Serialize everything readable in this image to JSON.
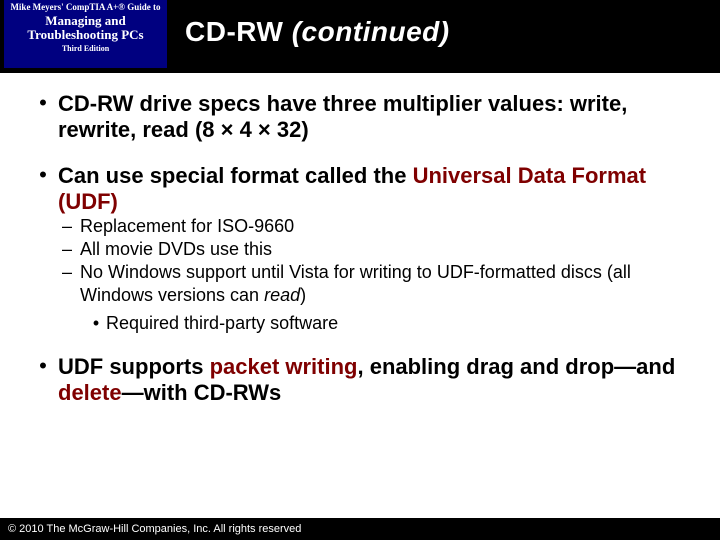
{
  "header": {
    "badge": {
      "line1": "Mike Meyers' CompTIA A+® Guide to",
      "line2": "Managing and Troubleshooting PCs",
      "line3": "Third Edition"
    },
    "title_main": "CD-RW ",
    "title_paren": "(continued)"
  },
  "bullets": {
    "b1_text": "CD-RW drive specs have three multiplier values: write, rewrite, read (8 × 4 × 32)",
    "b2_pre": "Can use special format called the ",
    "b2_accent": "Universal Data Format (UDF)",
    "b2_sub1": "Replacement for ISO-9660",
    "b2_sub2": "All movie DVDs use this",
    "b2_sub3_pre": "No Windows support until Vista for writing to UDF-formatted discs (all Windows versions can ",
    "b2_sub3_ital": "read",
    "b2_sub3_post": ")",
    "b2_sub3_sub": "Required third-party software",
    "b3_pre": "UDF supports ",
    "b3_a1": "packet writing",
    "b3_mid": ", enabling drag and drop—and ",
    "b3_a2": "delete",
    "b3_post": "—with CD-RWs"
  },
  "footer": {
    "copyright": "© 2010 The McGraw-Hill Companies, Inc. All rights reserved"
  },
  "glyphs": {
    "bullet": "•",
    "dash": "–"
  }
}
